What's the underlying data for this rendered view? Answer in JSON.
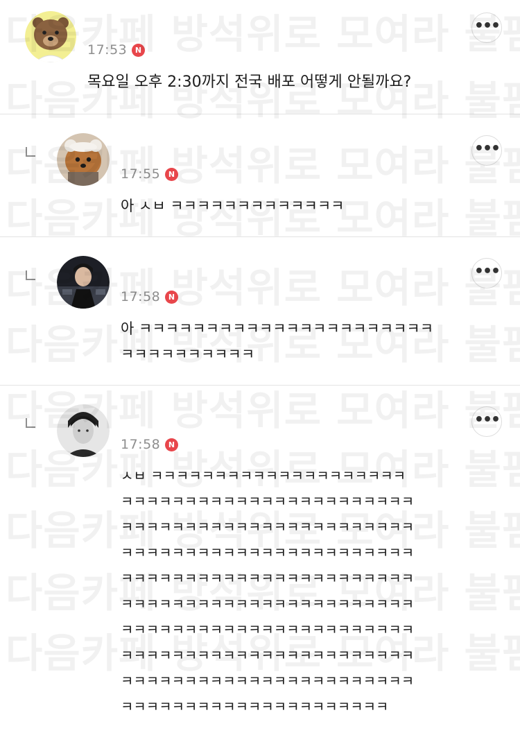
{
  "watermark": {
    "text": "다음카페 방석위로 모여라 불펌금지",
    "rows": [
      "r",
      "r",
      "r",
      "r",
      "r",
      "r",
      "r",
      "r",
      "r",
      "r",
      "r"
    ]
  },
  "comments": [
    {
      "time": "17:53",
      "badge": "N",
      "more_label": "•••",
      "lines": [
        "목요일 오후 2:30까지 전국 배포 어떻게 안될까요?"
      ]
    },
    {
      "time": "17:55",
      "badge": "N",
      "more_label": "•••",
      "lines": [
        "아 ㅅㅂ ㅋㅋㅋㅋㅋㅋㅋㅋㅋㅋㅋㅋㅋ"
      ]
    },
    {
      "time": "17:58",
      "badge": "N",
      "more_label": "•••",
      "lines": [
        "아 ㅋㅋㅋㅋㅋㅋㅋㅋㅋㅋㅋㅋㅋㅋㅋㅋㅋㅋㅋㅋㅋㅋ",
        "ㅋㅋㅋㅋㅋㅋㅋㅋㅋㅋ"
      ]
    },
    {
      "time": "17:58",
      "badge": "N",
      "more_label": "•••",
      "lines": [
        "ㅅㅂ ㅋㅋㅋㅋㅋㅋㅋㅋㅋㅋㅋㅋㅋㅋㅋㅋㅋㅋㅋㅋ",
        "ㅋㅋㅋㅋㅋㅋㅋㅋㅋㅋㅋㅋㅋㅋㅋㅋㅋㅋㅋㅋㅋㅋㅋ",
        "ㅋㅋㅋㅋㅋㅋㅋㅋㅋㅋㅋㅋㅋㅋㅋㅋㅋㅋㅋㅋㅋㅋㅋ",
        "ㅋㅋㅋㅋㅋㅋㅋㅋㅋㅋㅋㅋㅋㅋㅋㅋㅋㅋㅋㅋㅋㅋㅋ",
        "ㅋㅋㅋㅋㅋㅋㅋㅋㅋㅋㅋㅋㅋㅋㅋㅋㅋㅋㅋㅋㅋㅋㅋ",
        "ㅋㅋㅋㅋㅋㅋㅋㅋㅋㅋㅋㅋㅋㅋㅋㅋㅋㅋㅋㅋㅋㅋㅋ",
        "ㅋㅋㅋㅋㅋㅋㅋㅋㅋㅋㅋㅋㅋㅋㅋㅋㅋㅋㅋㅋㅋㅋㅋ",
        "ㅋㅋㅋㅋㅋㅋㅋㅋㅋㅋㅋㅋㅋㅋㅋㅋㅋㅋㅋㅋㅋㅋㅋ",
        "ㅋㅋㅋㅋㅋㅋㅋㅋㅋㅋㅋㅋㅋㅋㅋㅋㅋㅋㅋㅋㅋㅋㅋ",
        "ㅋㅋㅋㅋㅋㅋㅋㅋㅋㅋㅋㅋㅋㅋㅋㅋㅋㅋㅋㅋㅋ"
      ]
    }
  ]
}
